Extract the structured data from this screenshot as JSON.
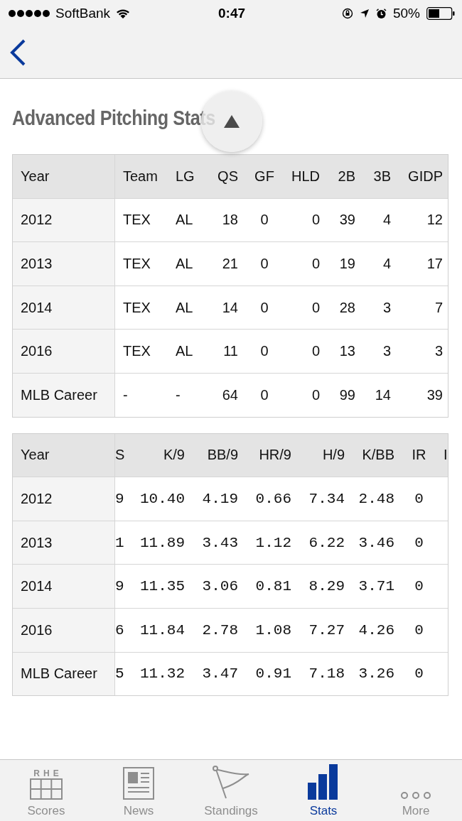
{
  "status_bar": {
    "carrier": "SoftBank",
    "time": "0:47",
    "battery": "50%"
  },
  "page": {
    "title": "Advanced Pitching Stats"
  },
  "tables": [
    {
      "columns": [
        "Year",
        "Team",
        "LG",
        "QS",
        "GF",
        "HLD",
        "2B",
        "3B",
        "GIDP"
      ],
      "rows": [
        [
          "2012",
          "TEX",
          "AL",
          "18",
          "0",
          "0",
          "39",
          "4",
          "12"
        ],
        [
          "2013",
          "TEX",
          "AL",
          "21",
          "0",
          "0",
          "19",
          "4",
          "17"
        ],
        [
          "2014",
          "TEX",
          "AL",
          "14",
          "0",
          "0",
          "28",
          "3",
          "7"
        ],
        [
          "2016",
          "TEX",
          "AL",
          "11",
          "0",
          "0",
          "13",
          "3",
          "3"
        ],
        [
          "MLB Career",
          "-",
          "-",
          "64",
          "0",
          "0",
          "99",
          "14",
          "39"
        ]
      ]
    },
    {
      "columns": [
        "Year",
        "S",
        "K/9",
        "BB/9",
        "HR/9",
        "H/9",
        "K/BB",
        "IR",
        "I"
      ],
      "rows": [
        [
          "2012",
          "9",
          "10.40",
          "4.19",
          "0.66",
          "7.34",
          "2.48",
          "0"
        ],
        [
          "2013",
          "1",
          "11.89",
          "3.43",
          "1.12",
          "6.22",
          "3.46",
          "0"
        ],
        [
          "2014",
          "9",
          "11.35",
          "3.06",
          "0.81",
          "8.29",
          "3.71",
          "0"
        ],
        [
          "2016",
          "6",
          "11.84",
          "2.78",
          "1.08",
          "7.27",
          "4.26",
          "0"
        ],
        [
          "MLB Career",
          "5",
          "11.32",
          "3.47",
          "0.91",
          "7.18",
          "3.26",
          "0"
        ]
      ]
    }
  ],
  "tab_bar": [
    {
      "label": "Scores",
      "icon_text": "RHE",
      "selected": false
    },
    {
      "label": "News",
      "selected": false
    },
    {
      "label": "Standings",
      "selected": false
    },
    {
      "label": "Stats",
      "selected": true
    },
    {
      "label": "More",
      "selected": false
    }
  ]
}
